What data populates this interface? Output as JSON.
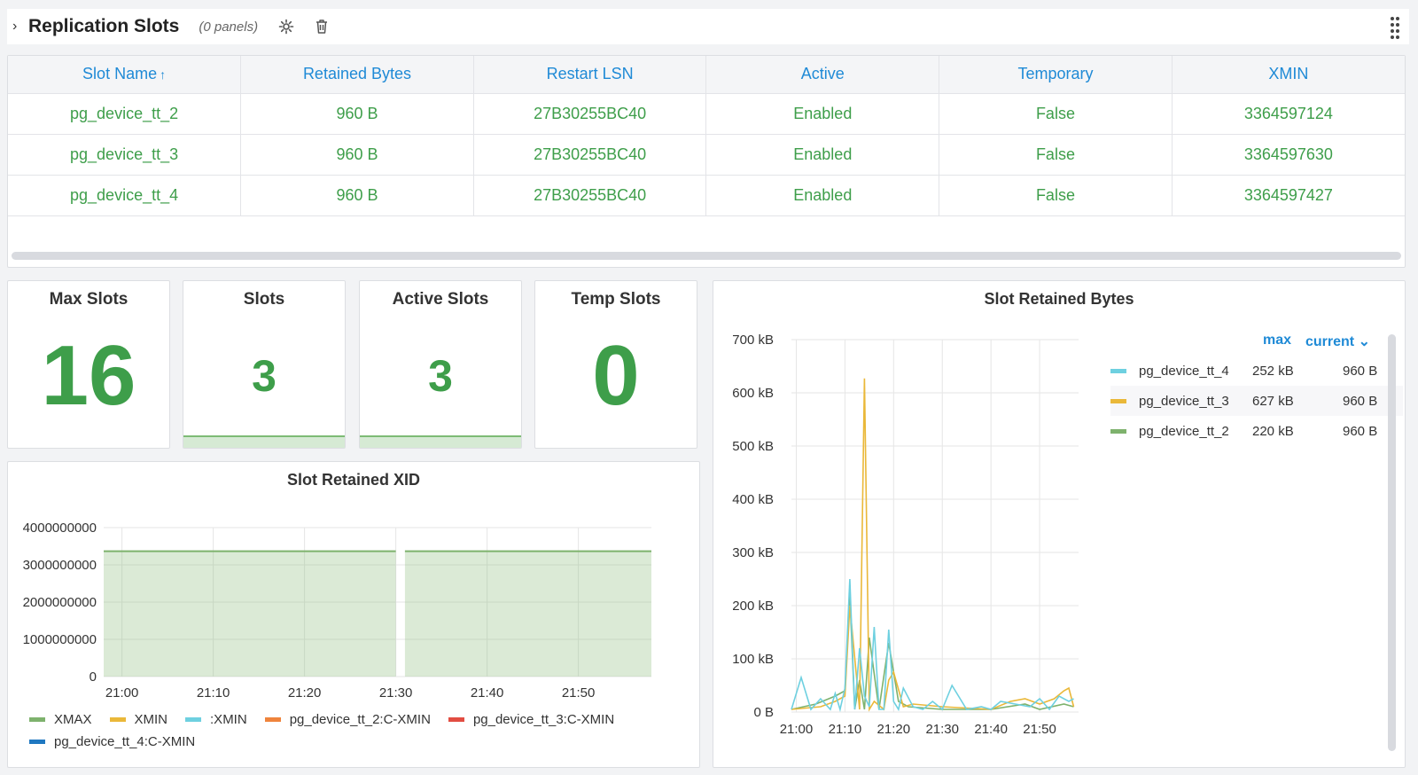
{
  "row": {
    "chevron": "›",
    "title": "Replication Slots",
    "panel_count": "(0 panels)"
  },
  "table": {
    "columns": [
      "Slot Name",
      "Retained Bytes",
      "Restart LSN",
      "Active",
      "Temporary",
      "XMIN"
    ],
    "sort_arrow": "↑",
    "rows": [
      [
        "pg_device_tt_2",
        "960 B",
        "27B30255BC40",
        "Enabled",
        "False",
        "3364597124"
      ],
      [
        "pg_device_tt_3",
        "960 B",
        "27B30255BC40",
        "Enabled",
        "False",
        "3364597630"
      ],
      [
        "pg_device_tt_4",
        "960 B",
        "27B30255BC40",
        "Enabled",
        "False",
        "3364597427"
      ]
    ]
  },
  "stats": [
    {
      "title": "Max Slots",
      "value": "16"
    },
    {
      "title": "Slots",
      "value": "3"
    },
    {
      "title": "Active Slots",
      "value": "3"
    },
    {
      "title": "Temp Slots",
      "value": "0"
    }
  ],
  "xid_chart": {
    "title": "Slot Retained XID",
    "legend": [
      {
        "label": "XMAX",
        "color": "#7eb26d"
      },
      {
        "label": "XMIN",
        "color": "#eab839"
      },
      {
        "label": ":XMIN",
        "color": "#6ed0e0"
      },
      {
        "label": "pg_device_tt_2:C-XMIN",
        "color": "#ef843c"
      },
      {
        "label": "pg_device_tt_3:C-XMIN",
        "color": "#e24d42"
      },
      {
        "label": "pg_device_tt_4:C-XMIN",
        "color": "#1f78c1"
      }
    ]
  },
  "bytes_chart": {
    "title": "Slot Retained Bytes",
    "legend_headers": {
      "max": "max",
      "current": "current ⌄"
    },
    "legend": [
      {
        "name": "pg_device_tt_4",
        "max": "252 kB",
        "current": "960 B",
        "color": "#6ed0e0"
      },
      {
        "name": "pg_device_tt_3",
        "max": "627 kB",
        "current": "960 B",
        "color": "#eab839"
      },
      {
        "name": "pg_device_tt_2",
        "max": "220 kB",
        "current": "960 B",
        "color": "#7eb26d"
      }
    ]
  },
  "chart_data": [
    {
      "type": "area",
      "title": "Slot Retained XID",
      "x_ticks": [
        "21:00",
        "21:10",
        "21:20",
        "21:30",
        "21:40",
        "21:50"
      ],
      "y_ticks": [
        "0",
        "1000000000",
        "2000000000",
        "3000000000",
        "4000000000"
      ],
      "ylim": [
        0,
        4000000000
      ],
      "series": [
        {
          "name": "XMAX",
          "x": [
            "20:58",
            "21:30",
            "21:31",
            "21:58"
          ],
          "values": [
            3364597700,
            3364597700,
            3364597700,
            3364597700
          ],
          "gap_after": "21:30"
        }
      ],
      "grid": true,
      "legend_position": "bottom"
    },
    {
      "type": "line",
      "title": "Slot Retained Bytes",
      "x_ticks": [
        "21:00",
        "21:10",
        "21:20",
        "21:30",
        "21:40",
        "21:50"
      ],
      "y_ticks": [
        "0 B",
        "100 kB",
        "200 kB",
        "300 kB",
        "400 kB",
        "500 kB",
        "600 kB",
        "700 kB"
      ],
      "ylim": [
        0,
        700
      ],
      "y_unit": "kB",
      "series": [
        {
          "name": "pg_device_tt_4",
          "color": "#6ed0e0",
          "x": [
            "20:59",
            "21:01",
            "21:03",
            "21:05",
            "21:07",
            "21:08",
            "21:09",
            "21:10",
            "21:11",
            "21:12",
            "21:13",
            "21:14",
            "21:15",
            "21:16",
            "21:17",
            "21:18",
            "21:19",
            "21:20",
            "21:21",
            "21:22",
            "21:24",
            "21:26",
            "21:28",
            "21:30",
            "21:32",
            "21:35",
            "21:38",
            "21:40",
            "21:42",
            "21:45",
            "21:48",
            "21:50",
            "21:52",
            "21:54",
            "21:56",
            "21:57"
          ],
          "values": [
            5,
            65,
            5,
            25,
            5,
            35,
            5,
            45,
            250,
            5,
            120,
            30,
            10,
            160,
            5,
            5,
            155,
            20,
            5,
            45,
            10,
            5,
            20,
            5,
            50,
            5,
            10,
            5,
            20,
            15,
            10,
            25,
            5,
            30,
            20,
            25
          ]
        },
        {
          "name": "pg_device_tt_3",
          "color": "#eab839",
          "x": [
            "20:59",
            "21:05",
            "21:08",
            "21:10",
            "21:11",
            "21:13",
            "21:14",
            "21:15",
            "21:16",
            "21:18",
            "21:19",
            "21:20",
            "21:22",
            "21:24",
            "21:30",
            "21:40",
            "21:44",
            "21:47",
            "21:50",
            "21:53",
            "21:55",
            "21:56",
            "21:57"
          ],
          "values": [
            5,
            10,
            20,
            30,
            200,
            5,
            627,
            5,
            20,
            5,
            60,
            75,
            10,
            15,
            10,
            5,
            20,
            25,
            15,
            25,
            40,
            45,
            10
          ]
        },
        {
          "name": "pg_device_tt_2",
          "color": "#7eb26d",
          "x": [
            "20:59",
            "21:04",
            "21:08",
            "21:10",
            "21:11",
            "21:12",
            "21:13",
            "21:14",
            "21:15",
            "21:17",
            "21:19",
            "21:21",
            "21:23",
            "21:30",
            "21:40",
            "21:47",
            "21:50",
            "21:55",
            "21:57"
          ],
          "values": [
            5,
            15,
            30,
            40,
            220,
            5,
            60,
            5,
            140,
            5,
            130,
            20,
            10,
            5,
            5,
            15,
            5,
            15,
            10
          ]
        }
      ],
      "grid": true,
      "legend_position": "right"
    }
  ]
}
